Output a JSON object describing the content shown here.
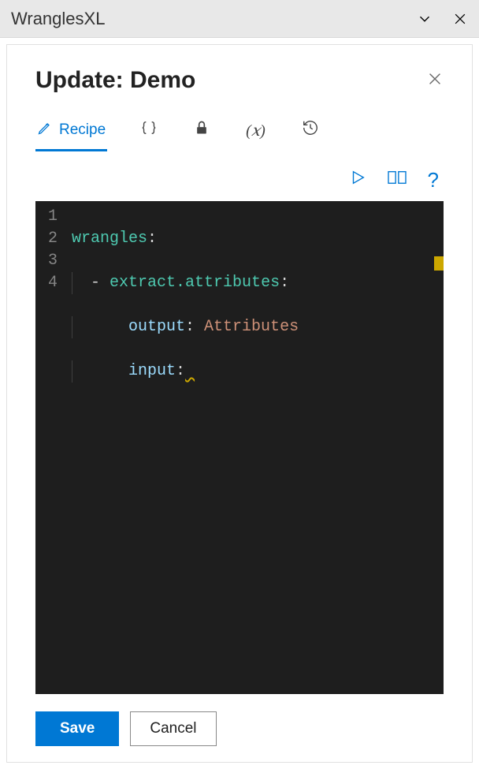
{
  "app": {
    "title": "WranglesXL"
  },
  "panel": {
    "title": "Update: Demo"
  },
  "tabs": {
    "recipe": {
      "label": "Recipe"
    }
  },
  "editor": {
    "lines": [
      "1",
      "2",
      "3",
      "4"
    ],
    "code": {
      "l1_key": "wrangles",
      "l2_dash": "- ",
      "l2_key": "extract.attributes",
      "l3_key": "output",
      "l3_val": "Attributes",
      "l4_key": "input",
      "l4_trail": " "
    }
  },
  "buttons": {
    "save": "Save",
    "cancel": "Cancel"
  }
}
